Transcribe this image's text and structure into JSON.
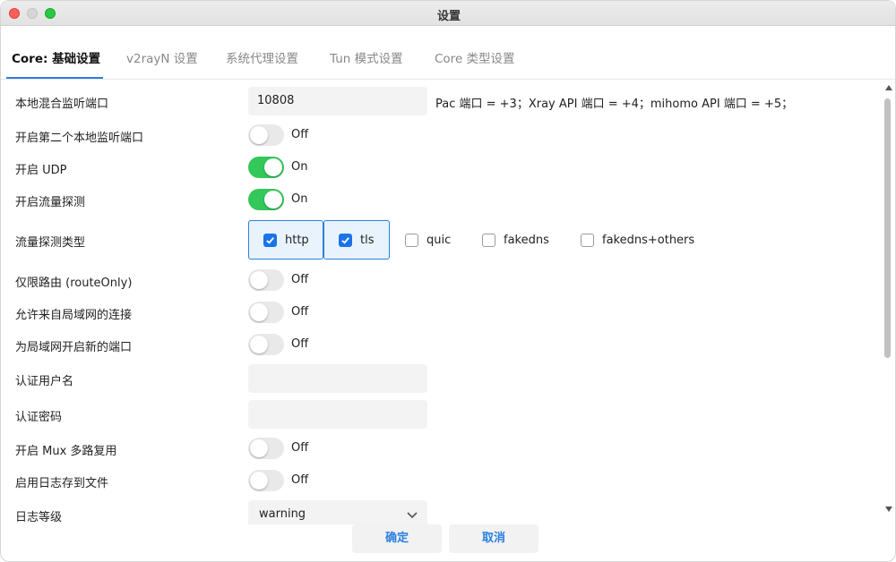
{
  "window": {
    "title": "设置"
  },
  "tabs": [
    {
      "label": "Core: 基础设置"
    },
    {
      "label": "v2rayN 设置"
    },
    {
      "label": "系统代理设置"
    },
    {
      "label": "Tun 模式设置"
    },
    {
      "label": "Core 类型设置"
    }
  ],
  "settings": {
    "local_port": {
      "label": "本地混合监听端口",
      "value": "10808",
      "hint": "Pac 端口 = +3；Xray API 端口 = +4；mihomo API 端口 = +5；"
    },
    "second_port": {
      "label": "开启第二个本地监听端口",
      "state": "Off"
    },
    "udp": {
      "label": "开启 UDP",
      "state": "On"
    },
    "sniffing": {
      "label": "开启流量探测",
      "state": "On"
    },
    "sniff_types": {
      "label": "流量探测类型",
      "options": [
        {
          "label": "http",
          "checked": true
        },
        {
          "label": "tls",
          "checked": true
        },
        {
          "label": "quic",
          "checked": false
        },
        {
          "label": "fakedns",
          "checked": false
        },
        {
          "label": "fakedns+others",
          "checked": false
        }
      ]
    },
    "route_only": {
      "label": "仅限路由 (routeOnly)",
      "state": "Off"
    },
    "allow_lan": {
      "label": "允许来自局域网的连接",
      "state": "Off"
    },
    "lan_new_port": {
      "label": "为局域网开启新的端口",
      "state": "Off"
    },
    "auth_user": {
      "label": "认证用户名",
      "value": ""
    },
    "auth_pass": {
      "label": "认证密码",
      "value": ""
    },
    "mux": {
      "label": "开启 Mux 多路复用",
      "state": "Off"
    },
    "log_file": {
      "label": "启用日志存到文件",
      "state": "Off"
    },
    "log_level": {
      "label": "日志等级",
      "value": "warning"
    }
  },
  "footer": {
    "ok": "确定",
    "cancel": "取消"
  },
  "colors": {
    "accent": "#2a7fe0",
    "toggle_on": "#34c759"
  }
}
